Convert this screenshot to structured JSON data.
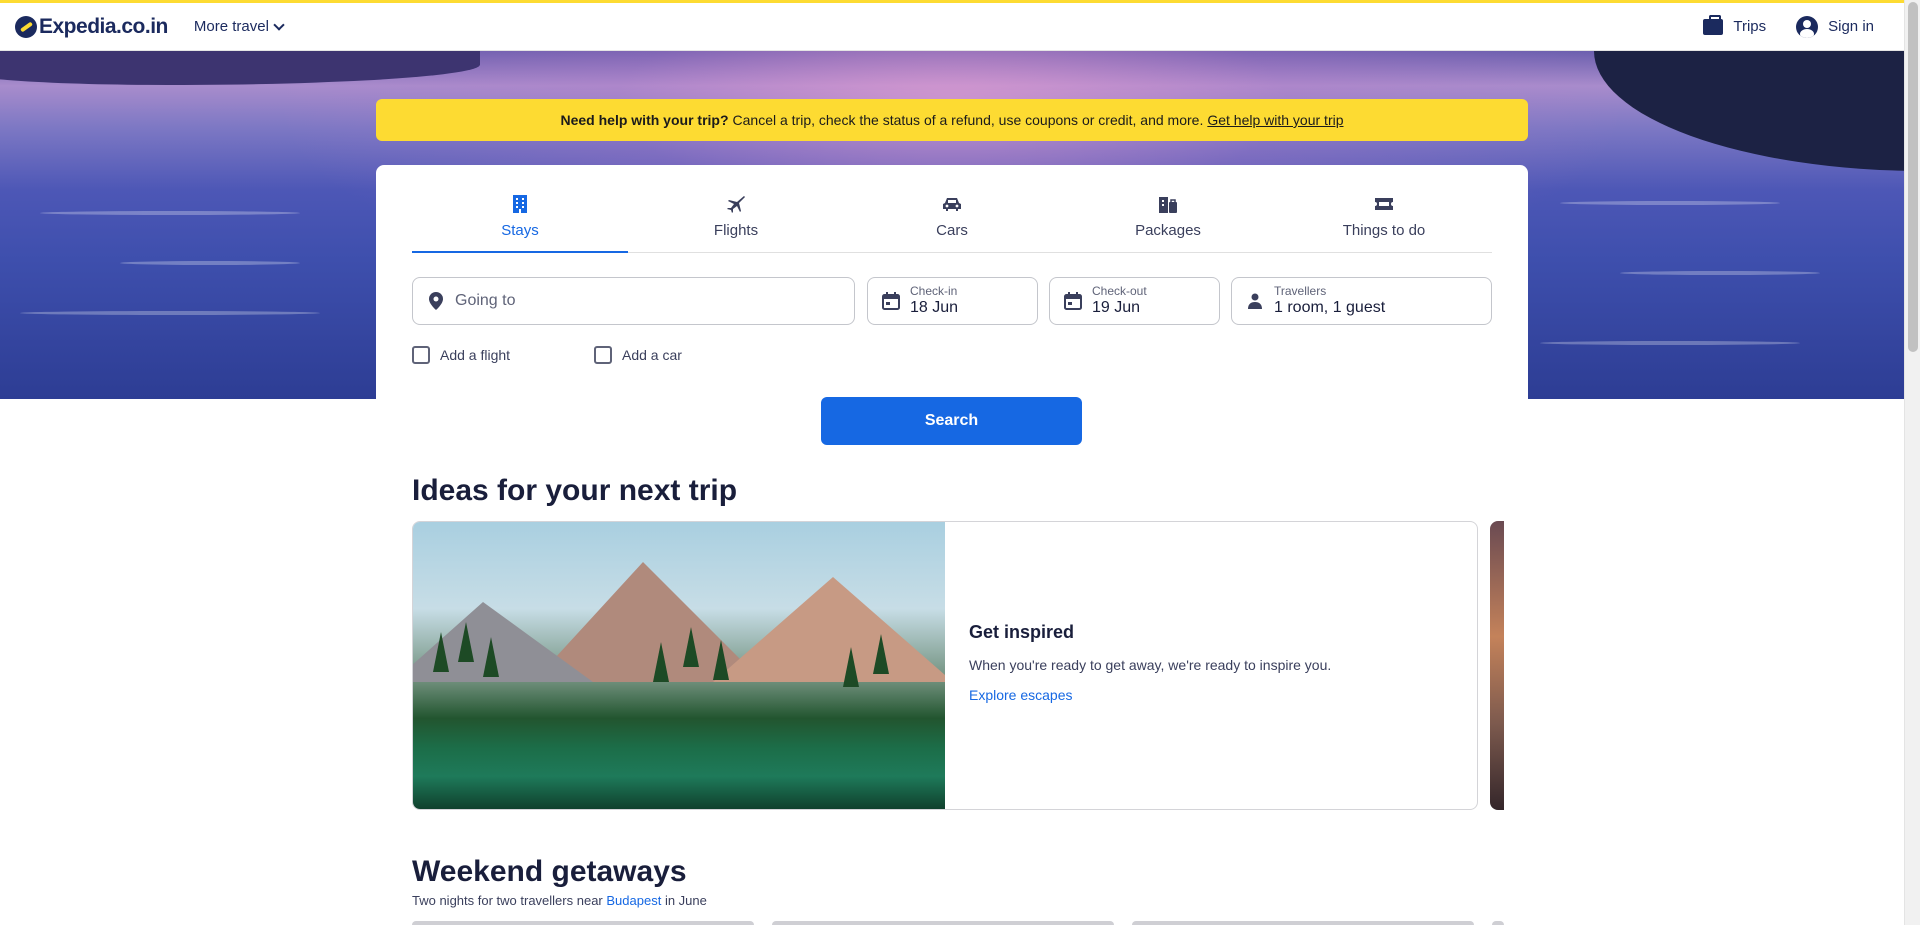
{
  "brand": {
    "logo_text": "Expedia.co.in",
    "accent": "#fddb32",
    "primary": "#1668e3"
  },
  "header": {
    "more_travel": "More travel",
    "trips": "Trips",
    "sign_in": "Sign in"
  },
  "banner": {
    "bold": "Need help with your trip?",
    "text": "Cancel a trip, check the status of a refund, use coupons or credit, and more.",
    "link": "Get help with your trip"
  },
  "tabs": [
    {
      "label": "Stays",
      "icon": "building-icon",
      "active": true
    },
    {
      "label": "Flights",
      "icon": "plane-icon",
      "active": false
    },
    {
      "label": "Cars",
      "icon": "car-icon",
      "active": false
    },
    {
      "label": "Packages",
      "icon": "packages-icon",
      "active": false
    },
    {
      "label": "Things to do",
      "icon": "ticket-icon",
      "active": false
    }
  ],
  "search": {
    "going_to_placeholder": "Going to",
    "checkin_label": "Check-in",
    "checkin_value": "18 Jun",
    "checkout_label": "Check-out",
    "checkout_value": "19 Jun",
    "travellers_label": "Travellers",
    "travellers_value": "1 room, 1 guest",
    "add_flight": "Add a flight",
    "add_car": "Add a car",
    "button": "Search"
  },
  "ideas": {
    "title": "Ideas for your next trip",
    "card_heading": "Get inspired",
    "card_text": "When you're ready to get away, we're ready to inspire you.",
    "card_link": "Explore escapes"
  },
  "weekend": {
    "title": "Weekend getaways",
    "subtitle_before": "Two nights for two travellers near",
    "subtitle_link": "Budapest",
    "subtitle_after": "in June"
  }
}
